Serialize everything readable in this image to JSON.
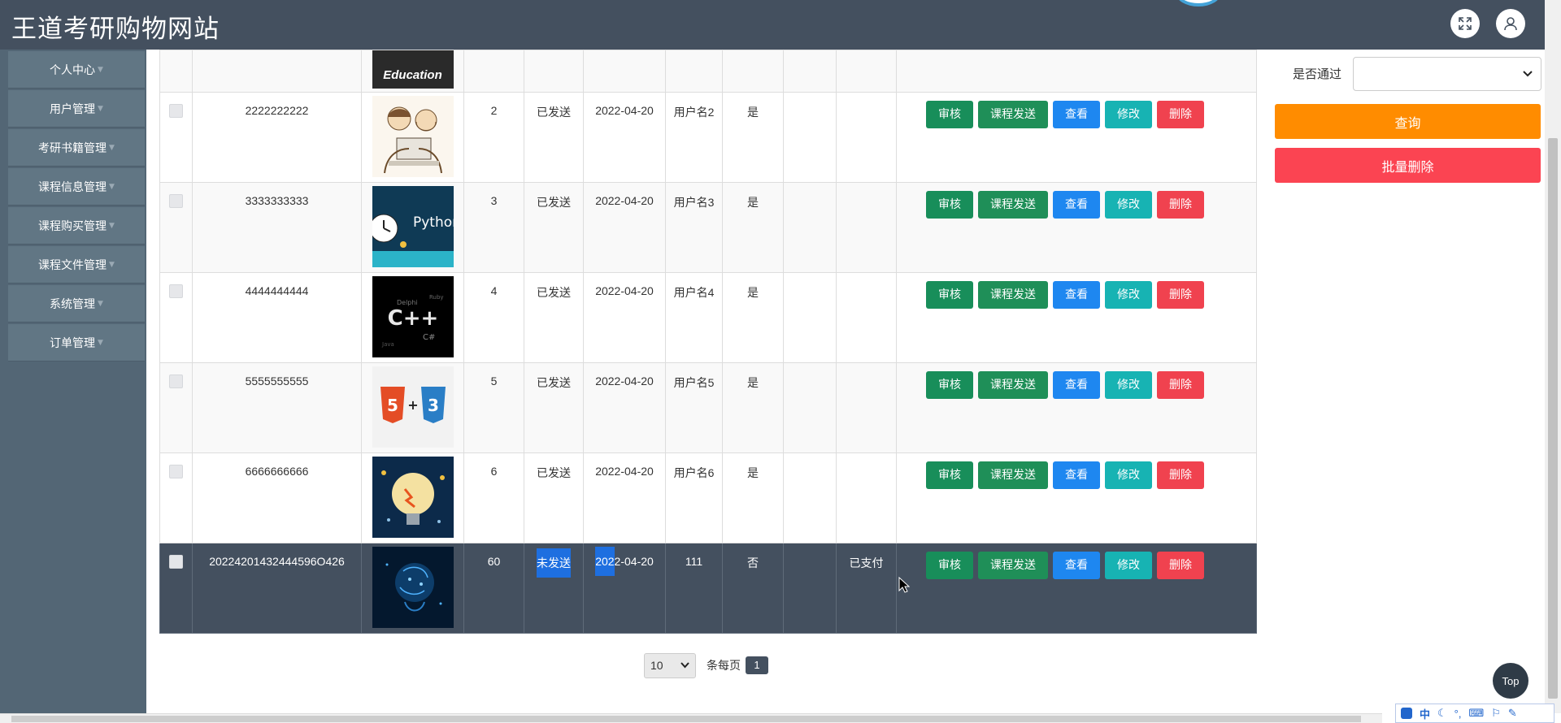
{
  "header": {
    "title": "王道考研购物网站"
  },
  "sidebar": {
    "items": [
      {
        "label": "个人中心"
      },
      {
        "label": "用户管理"
      },
      {
        "label": "考研书籍管理"
      },
      {
        "label": "课程信息管理"
      },
      {
        "label": "课程购买管理"
      },
      {
        "label": "课程文件管理"
      },
      {
        "label": "系统管理"
      },
      {
        "label": "订单管理"
      }
    ]
  },
  "actions": {
    "audit": "审核",
    "send": "课程发送",
    "view": "查看",
    "edit": "修改",
    "delete": "删除"
  },
  "rows": [
    {
      "order_no": "2222222222",
      "qty": "2",
      "send_status": "已发送",
      "date": "2022-04-20",
      "user": "用户名2",
      "passed": "是",
      "pay_status": "",
      "image": "cartoon-programmers"
    },
    {
      "order_no": "3333333333",
      "qty": "3",
      "send_status": "已发送",
      "date": "2022-04-20",
      "user": "用户名3",
      "passed": "是",
      "pay_status": "",
      "image": "python-clock"
    },
    {
      "order_no": "4444444444",
      "qty": "4",
      "send_status": "已发送",
      "date": "2022-04-20",
      "user": "用户名4",
      "passed": "是",
      "pay_status": "",
      "image": "cpp-word-cloud"
    },
    {
      "order_no": "5555555555",
      "qty": "5",
      "send_status": "已发送",
      "date": "2022-04-20",
      "user": "用户名5",
      "passed": "是",
      "pay_status": "",
      "image": "html5-css3"
    },
    {
      "order_no": "6666666666",
      "qty": "6",
      "send_status": "已发送",
      "date": "2022-04-20",
      "user": "用户名6",
      "passed": "是",
      "pay_status": "",
      "image": "lightbulb-ideas"
    },
    {
      "order_no": "20224201432444596O426",
      "qty": "60",
      "send_status": "未发送",
      "date": "2022-04-20",
      "user": "111",
      "passed": "否",
      "pay_status": "已支付",
      "image": "digital-head"
    }
  ],
  "partial_row": {
    "image_text": "Education"
  },
  "filter": {
    "label": "是否通过",
    "select_value": ""
  },
  "buttons": {
    "query": "查询",
    "batch_delete": "批量删除"
  },
  "pagination": {
    "page_size": "10",
    "per_page_label": "条每页",
    "current_page": "1"
  },
  "top_button": "Top",
  "ime": {
    "lang": "中"
  },
  "colors": {
    "header": "#44505f",
    "sidebar": "#536675",
    "audit": "#188e5a",
    "view": "#1e87f0",
    "edit": "#17b3b3",
    "delete": "#f0424f",
    "query": "#ff8c00",
    "batch_delete": "#fb4452"
  }
}
